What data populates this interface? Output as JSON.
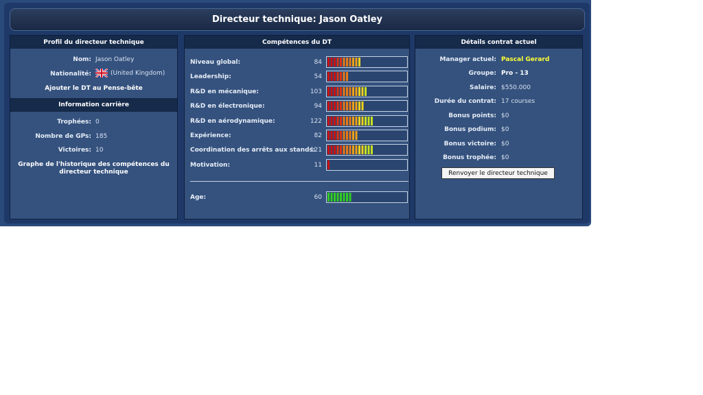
{
  "window": {
    "title": "Directeur technique: Jason Oatley"
  },
  "profile": {
    "header": "Profil du directeur technique",
    "name_label": "Nom:",
    "name_value": "Jason Oatley",
    "nationality_label": "Nationalité:",
    "nationality_value": "(United Kingdom)",
    "flag_icon": "uk-flag-icon",
    "shortlist_link": "Ajouter le DT au Pense-bête",
    "career_header": "Information carrière",
    "trophies_label": "Trophées:",
    "trophies_value": "0",
    "gps_label": "Nombre de GPs:",
    "gps_value": "185",
    "wins_label": "Victoires:",
    "wins_value": "10",
    "history_link": "Graphe de l'historique des compétences du directeur technique"
  },
  "skills": {
    "header": "Compétences du DT",
    "max": 200,
    "items": [
      {
        "label": "Niveau global:",
        "value": "84",
        "level": 84
      },
      {
        "label": "Leadership:",
        "value": "54",
        "level": 54
      },
      {
        "label": "R&D en mécanique:",
        "value": "103",
        "level": 103
      },
      {
        "label": "R&D en électronique:",
        "value": "94",
        "level": 94
      },
      {
        "label": "R&D en aérodynamique:",
        "value": "122",
        "level": 122
      },
      {
        "label": "Expérience:",
        "value": "82",
        "level": 82
      },
      {
        "label": "Coordination des arrêts aux stands:",
        "value": "121",
        "level": 121
      },
      {
        "label": "Motivation:",
        "value": "11",
        "level": 11
      }
    ],
    "age": {
      "label": "Age:",
      "value": "60",
      "level": 60
    }
  },
  "contract": {
    "header": "Détails contrat actuel",
    "rows": [
      {
        "label": "Manager actuel:",
        "value": "Pascal Gerard"
      },
      {
        "label": "Groupe:",
        "value": "Pro - 13"
      },
      {
        "label": "Salaire:",
        "value": "$550.000"
      },
      {
        "label": "Durée du contrat:",
        "value": "17 courses"
      },
      {
        "label": "Bonus points:",
        "value": "$0"
      },
      {
        "label": "Bonus podium:",
        "value": "$0"
      },
      {
        "label": "Bonus victoire:",
        "value": "$0"
      },
      {
        "label": "Bonus trophée:",
        "value": "$0"
      }
    ],
    "manager_color": "#ffff33",
    "fire_button": "Renvoyer le directeur technique"
  }
}
